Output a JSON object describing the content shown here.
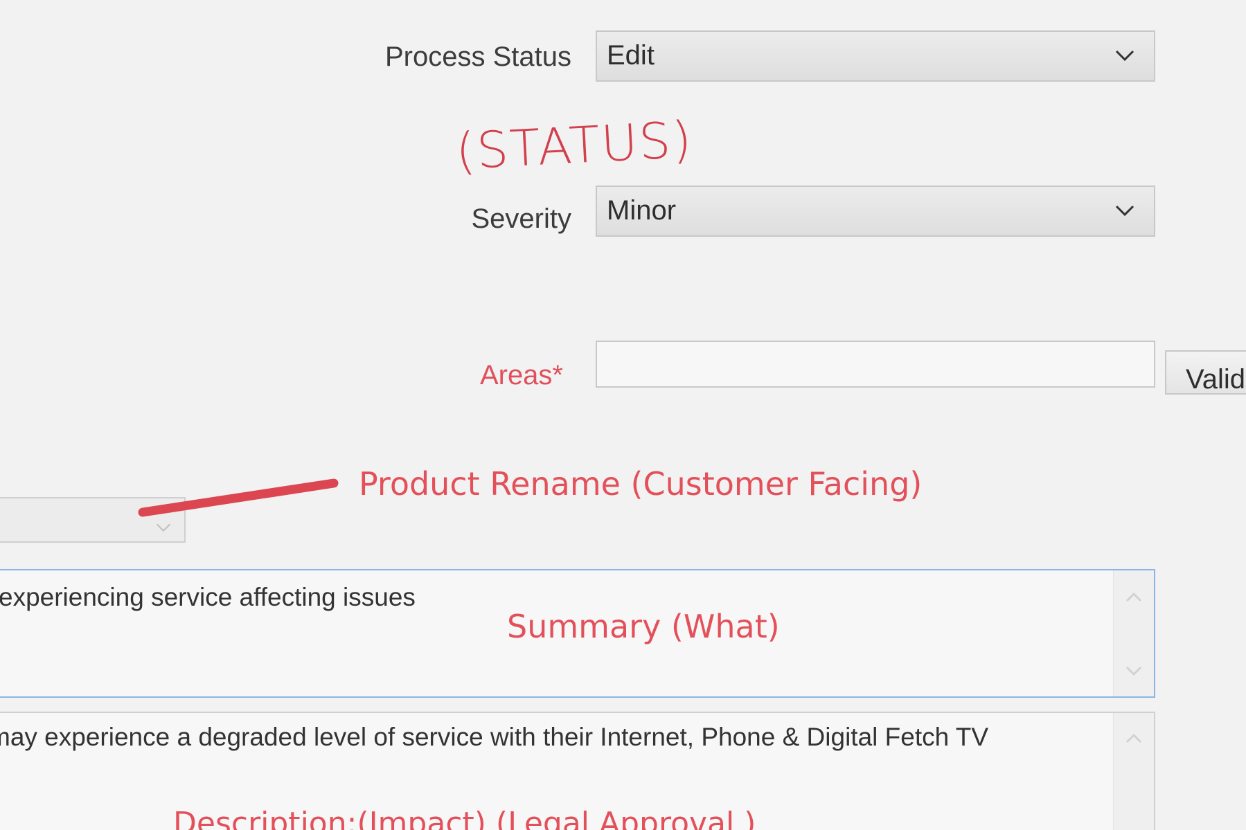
{
  "form": {
    "process_status": {
      "label": "Process Status",
      "value": "Edit"
    },
    "severity": {
      "label": "Severity",
      "value": "Minor"
    },
    "areas": {
      "label": "Areas*",
      "value": "",
      "button_label": "Valid"
    },
    "summary": {
      "text": "experiencing service affecting issues"
    },
    "description": {
      "text": "may experience a degraded level of service with their Internet, Phone & Digital Fetch TV"
    }
  },
  "annotations": {
    "status_note": "(STATUS)",
    "product_rename": "Product Rename (Customer Facing)",
    "summary_what": "Summary (What)",
    "description_impact": "Description:(Impact) (Legal Approval )"
  },
  "colors": {
    "annotation": "#e3505a",
    "required_label": "#e0505a",
    "focus_border": "#8cb4e6"
  },
  "icons": {
    "dropdown": "chevron-down-icon",
    "scroll_up": "chevron-up-icon",
    "scroll_down": "chevron-down-icon"
  }
}
